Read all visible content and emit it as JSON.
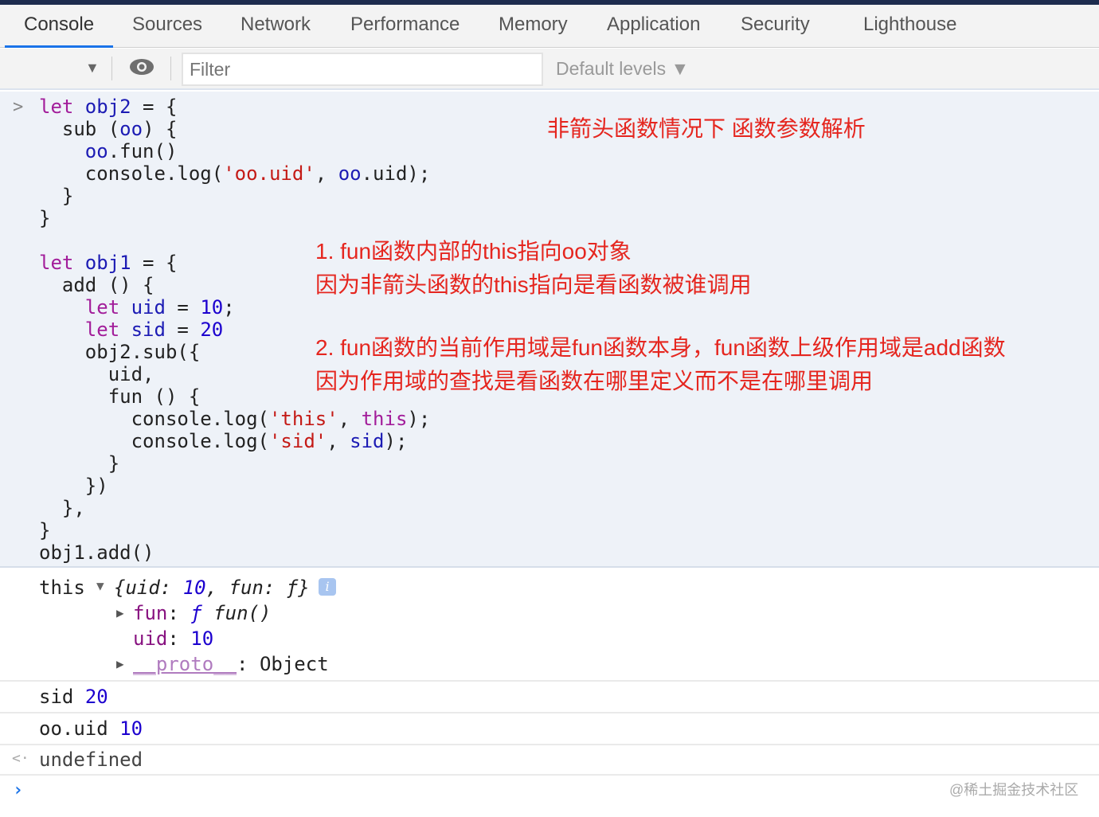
{
  "tabs": [
    {
      "label": "Console",
      "active": true
    },
    {
      "label": "Sources"
    },
    {
      "label": "Network"
    },
    {
      "label": "Performance"
    },
    {
      "label": "Memory"
    },
    {
      "label": "Application"
    },
    {
      "label": "Security"
    },
    {
      "label": "Lighthouse"
    }
  ],
  "toolbar": {
    "filter_placeholder": "Filter",
    "levels_label": "Default levels ▼",
    "context_arrow": "▼"
  },
  "input": {
    "prompt": ">",
    "code_lines": [
      [
        [
          "let ",
          "kw"
        ],
        [
          "obj2",
          "var"
        ],
        [
          " = {",
          "pl"
        ]
      ],
      [
        [
          "  sub (",
          "pl"
        ],
        [
          "oo",
          "var"
        ],
        [
          ") {",
          "pl"
        ]
      ],
      [
        [
          "    ",
          "pl"
        ],
        [
          "oo",
          "var"
        ],
        [
          ".fun()",
          "pl"
        ]
      ],
      [
        [
          "    console.log(",
          "pl"
        ],
        [
          "'oo.uid'",
          "str"
        ],
        [
          ", ",
          "pl"
        ],
        [
          "oo",
          "var"
        ],
        [
          ".uid);",
          "pl"
        ]
      ],
      [
        [
          "  }",
          "pl"
        ]
      ],
      [
        [
          "}",
          "pl"
        ]
      ],
      [
        [
          "",
          "pl"
        ]
      ],
      [
        [
          "let ",
          "kw"
        ],
        [
          "obj1",
          "var"
        ],
        [
          " = {",
          "pl"
        ]
      ],
      [
        [
          "  add () {",
          "pl"
        ]
      ],
      [
        [
          "    ",
          "pl"
        ],
        [
          "let ",
          "kw"
        ],
        [
          "uid",
          "var"
        ],
        [
          " = ",
          "pl"
        ],
        [
          "10",
          "num"
        ],
        [
          ";",
          "pl"
        ]
      ],
      [
        [
          "    ",
          "pl"
        ],
        [
          "let ",
          "kw"
        ],
        [
          "sid",
          "var"
        ],
        [
          " = ",
          "pl"
        ],
        [
          "20",
          "num"
        ]
      ],
      [
        [
          "    obj2.sub({",
          "pl"
        ]
      ],
      [
        [
          "      uid,",
          "pl"
        ]
      ],
      [
        [
          "      fun () {",
          "pl"
        ]
      ],
      [
        [
          "        console.log(",
          "pl"
        ],
        [
          "'this'",
          "str"
        ],
        [
          ", ",
          "pl"
        ],
        [
          "this",
          "kw"
        ],
        [
          ");",
          "pl"
        ]
      ],
      [
        [
          "        console.log(",
          "pl"
        ],
        [
          "'sid'",
          "str"
        ],
        [
          ", ",
          "pl"
        ],
        [
          "sid",
          "var"
        ],
        [
          ");",
          "pl"
        ]
      ],
      [
        [
          "      }",
          "pl"
        ]
      ],
      [
        [
          "    })",
          "pl"
        ]
      ],
      [
        [
          "  },",
          "pl"
        ]
      ],
      [
        [
          "}",
          "pl"
        ]
      ],
      [
        [
          "obj1.add()",
          "pl"
        ]
      ]
    ]
  },
  "annotations": {
    "title": "非箭头函数情况下 函数参数解析",
    "note1_line1": "1. fun函数内部的this指向oo对象",
    "note1_line2": "因为非箭头函数的this指向是看函数被谁调用",
    "note2_line1": "2. fun函数的当前作用域是fun函数本身，fun函数上级作用域是add函数",
    "note2_line2": "因为作用域的查找是看函数在哪里定义而不是在哪里调用"
  },
  "output": {
    "this_label": "this",
    "this_summary_open": "{uid: ",
    "this_summary_uid": "10",
    "this_summary_rest": ", fun: ƒ}",
    "info_badge": "i",
    "fun_key": "fun",
    "fun_f": "ƒ",
    "fun_value": "fun()",
    "uid_key": "uid",
    "uid_value": "10",
    "proto_key": "__proto__",
    "proto_value": "Object",
    "sid_label": "sid",
    "sid_value": "20",
    "oouid_label": "oo.uid",
    "oouid_value": "10",
    "return_value": "undefined"
  },
  "watermark": "@稀土掘金技术社区"
}
